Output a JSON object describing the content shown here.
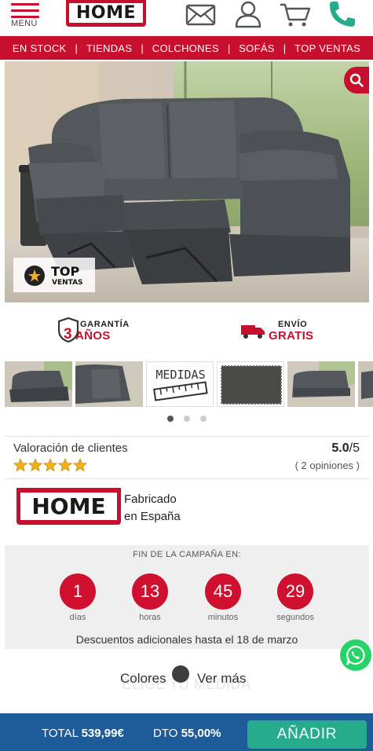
{
  "header": {
    "menu_label": "MENÚ",
    "logo_text": "HOME",
    "icons": [
      "mail-icon",
      "user-icon",
      "cart-icon",
      "phone-icon"
    ]
  },
  "nav": {
    "items": [
      {
        "label": "EN STOCK"
      },
      {
        "label": "TIENDAS"
      },
      {
        "label": "COLCHONES"
      },
      {
        "label": "SOFÁS"
      },
      {
        "label": "TOP VENTAS"
      }
    ]
  },
  "hero": {
    "badge_line1": "TOP",
    "badge_line2": "VENTAS",
    "search_icon": "search-icon"
  },
  "guarantees": {
    "warranty_small": "GARANTÍA",
    "warranty_number": "3",
    "warranty_big": "AÑOS",
    "shipping_small": "ENVÍO",
    "shipping_big": "GRATIS"
  },
  "gallery": {
    "measures_label": "MEDIDAS",
    "active_dot": 1,
    "dot_count": 3
  },
  "rating": {
    "title": "Valoración de clientes",
    "score": "5.0",
    "score_suffix": "/5",
    "stars": 5,
    "opinions": "( 2 opiniones )"
  },
  "made_in": {
    "logo_text": "HOME",
    "line1": "Fabricado",
    "line2": "en España"
  },
  "campaign": {
    "caption": "FIN DE LA CAMPAÑA EN:",
    "countdown": [
      {
        "value": "1",
        "unit": "días"
      },
      {
        "value": "13",
        "unit": "horas"
      },
      {
        "value": "45",
        "unit": "minutos"
      },
      {
        "value": "29",
        "unit": "segundos"
      }
    ],
    "discount_note": "Descuentos adicionales hasta el 18 de marzo"
  },
  "options": {
    "ghost_heading": "ELIGE TU MEDIDA",
    "colors_label": "Colores",
    "more_label": "Ver más"
  },
  "bottom_bar": {
    "total_label": "TOTAL",
    "total_value": "539,99€",
    "discount_label": "DTO",
    "discount_value": "55,00%",
    "add_label": "AÑADIR"
  },
  "colors": {
    "brand_red": "#c8102e",
    "bar_blue": "#1e5b98",
    "add_green": "#26ac8c",
    "whatsapp_green": "#25d366",
    "star_gold": "#f2b01e"
  }
}
